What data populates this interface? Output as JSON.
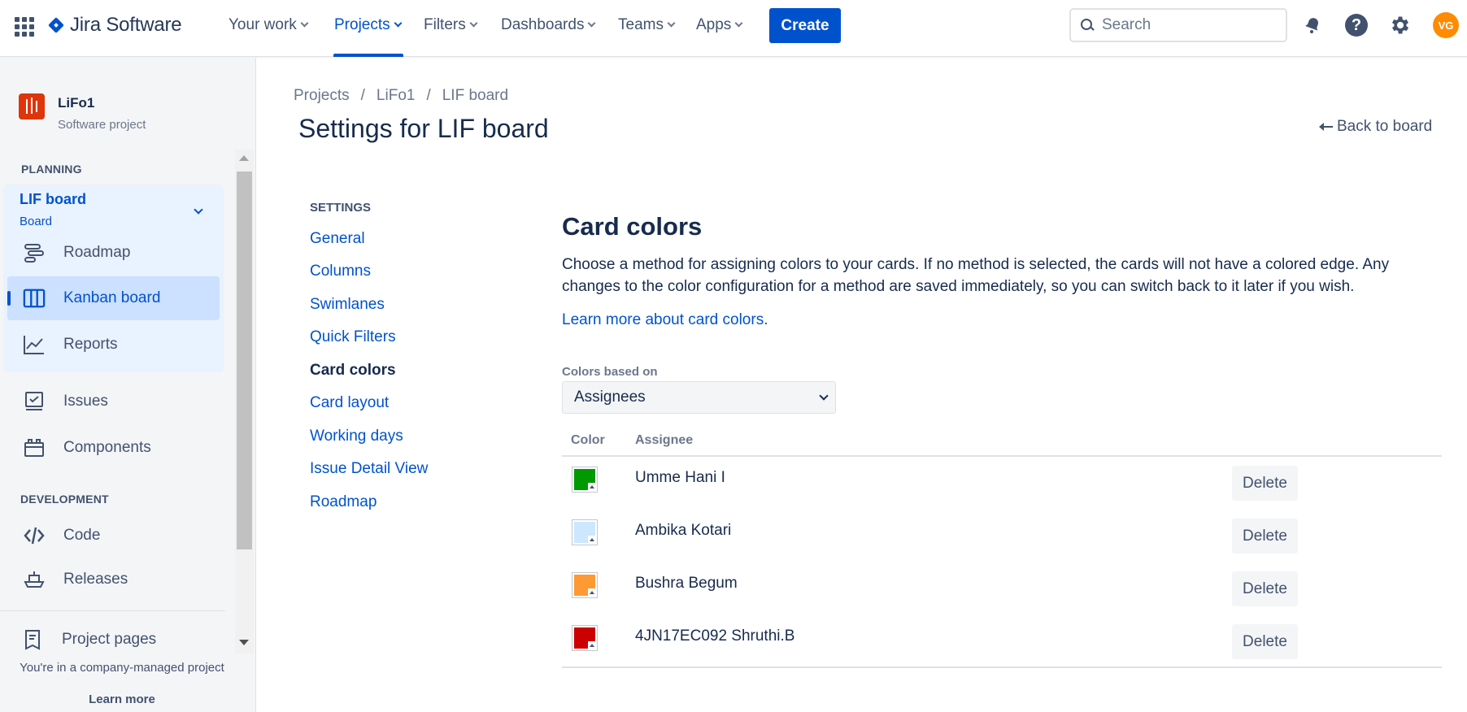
{
  "topnav": {
    "logo_text": "Jira Software",
    "items": [
      {
        "label": "Your work"
      },
      {
        "label": "Projects"
      },
      {
        "label": "Filters"
      },
      {
        "label": "Dashboards"
      },
      {
        "label": "Teams"
      },
      {
        "label": "Apps"
      }
    ],
    "active_item": "Projects",
    "create_label": "Create",
    "search_placeholder": "Search",
    "avatar_initials": "VG",
    "colors": {
      "brand": "#0052cc",
      "avatar": "#ff8b00"
    }
  },
  "sidebar": {
    "project_name": "LiFo1",
    "project_type": "Software project",
    "planning_label": "PLANNING",
    "board": {
      "title": "LIF board",
      "subtitle": "Board"
    },
    "planning_items": [
      {
        "label": "Roadmap",
        "icon": "roadmap-icon"
      },
      {
        "label": "Kanban board",
        "icon": "kanban-board-icon",
        "active": true
      },
      {
        "label": "Reports",
        "icon": "reports-icon"
      }
    ],
    "other_items": [
      {
        "label": "Issues",
        "icon": "issues-icon"
      },
      {
        "label": "Components",
        "icon": "components-icon"
      }
    ],
    "development_label": "DEVELOPMENT",
    "dev_items": [
      {
        "label": "Code",
        "icon": "code-icon"
      },
      {
        "label": "Releases",
        "icon": "releases-icon"
      }
    ],
    "project_pages_label": "Project pages",
    "footer_note": "You're in a company-managed project",
    "footer_link": "Learn more"
  },
  "breadcrumb": [
    "Projects",
    "LiFo1",
    "LIF board"
  ],
  "breadcrumb_separator": "/",
  "page_title": "Settings for LIF board",
  "back_link": "Back to board",
  "settings_nav": {
    "label": "SETTINGS",
    "items": [
      "General",
      "Columns",
      "Swimlanes",
      "Quick Filters",
      "Card colors",
      "Card layout",
      "Working days",
      "Issue Detail View",
      "Roadmap"
    ],
    "active": "Card colors"
  },
  "card_colors": {
    "title": "Card colors",
    "description": "Choose a method for assigning colors to your cards. If no method is selected, the cards will not have a colored edge. Any changes to the color configuration for a method are saved immediately, so you can switch back to it later if you wish.",
    "learn_more": "Learn more about card colors.",
    "field_label": "Colors based on",
    "selected_method": "Assignees",
    "columns": {
      "color": "Color",
      "assignee": "Assignee"
    },
    "delete_label": "Delete",
    "rows": [
      {
        "assignee": "Umme Hani I",
        "color": "#009900"
      },
      {
        "assignee": "Ambika Kotari",
        "color": "#cce7ff"
      },
      {
        "assignee": "Bushra Begum",
        "color": "#ff9933"
      },
      {
        "assignee": "4JN17EC092 Shruthi.B",
        "color": "#cc0000"
      }
    ]
  }
}
